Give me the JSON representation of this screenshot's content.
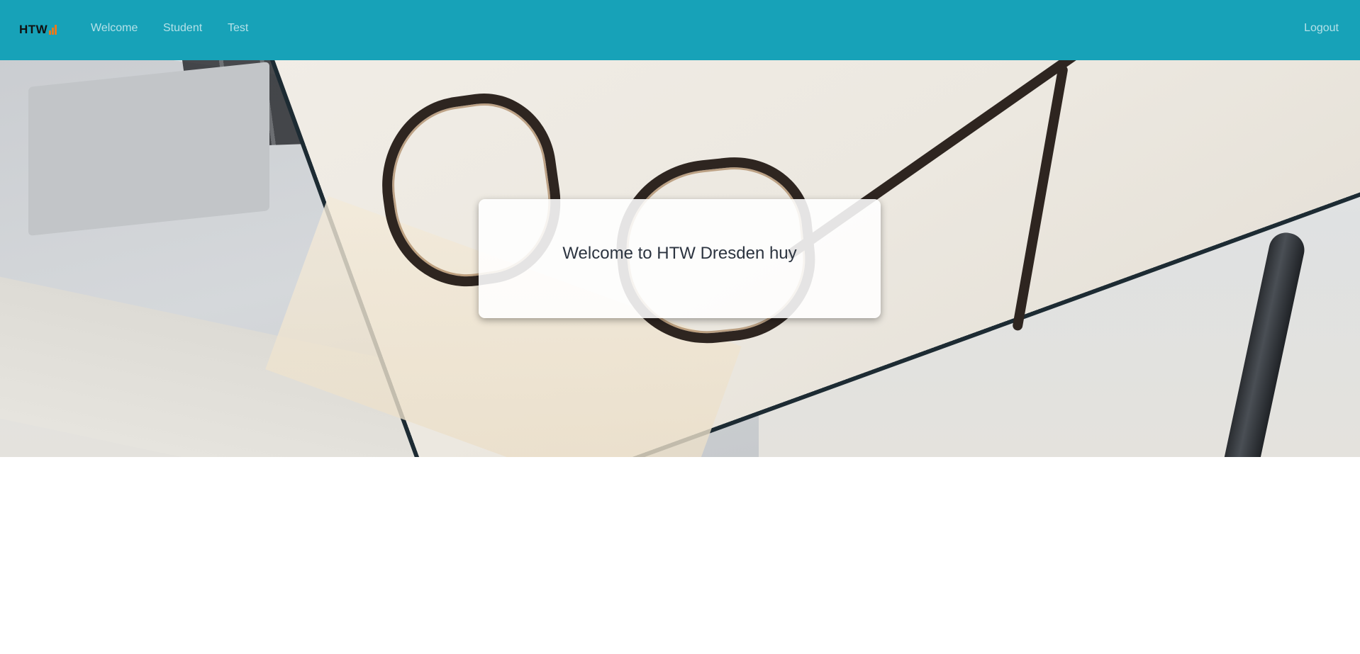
{
  "navbar": {
    "brand": "HTW",
    "brand_accent_color": "#e87a1e",
    "background_color": "#17a2b8",
    "links": [
      {
        "label": "Welcome"
      },
      {
        "label": "Student"
      },
      {
        "label": "Test"
      }
    ],
    "logout_label": "Logout"
  },
  "hero": {
    "welcome_text": "Welcome to HTW Dresden huy"
  }
}
